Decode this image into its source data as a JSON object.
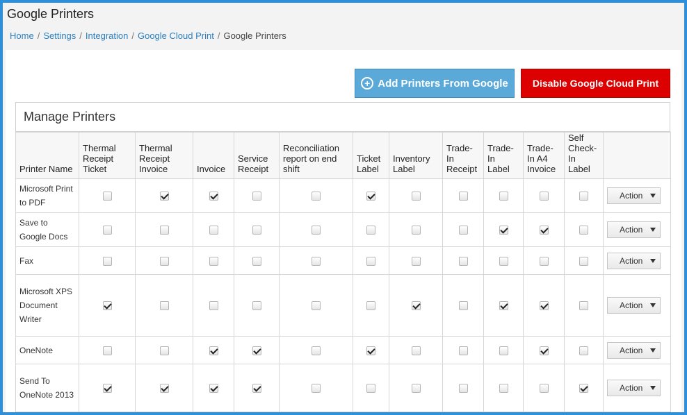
{
  "page": {
    "title": "Google Printers",
    "breadcrumb": [
      "Home",
      "Settings",
      "Integration",
      "Google Cloud Print"
    ],
    "breadcrumb_current": "Google Printers"
  },
  "toolbar": {
    "add_label": "Add Printers From Google",
    "disable_label": "Disable Google Cloud Print"
  },
  "panel": {
    "title": "Manage Printers"
  },
  "table": {
    "columns": [
      "Printer Name",
      "Thermal Receipt Ticket",
      "Thermal Receipt Invoice",
      "Invoice",
      "Service Receipt",
      "Reconciliation report on end shift",
      "Ticket Label",
      "Inventory Label",
      "Trade-In Receipt",
      "Trade-In Label",
      "Trade-In A4 Invoice",
      "Self Check-In Label",
      ""
    ],
    "action_label": "Action",
    "rows": [
      {
        "name": "Microsoft Print to PDF",
        "checks": [
          false,
          true,
          true,
          false,
          false,
          true,
          false,
          false,
          false,
          false,
          false
        ]
      },
      {
        "name": "Save to Google Docs",
        "checks": [
          false,
          false,
          false,
          false,
          false,
          false,
          false,
          false,
          true,
          true,
          false
        ]
      },
      {
        "name": "Fax",
        "checks": [
          false,
          false,
          false,
          false,
          false,
          false,
          false,
          false,
          false,
          false,
          false
        ]
      },
      {
        "name": "Microsoft XPS Document Writer",
        "checks": [
          true,
          false,
          false,
          false,
          false,
          false,
          true,
          false,
          true,
          true,
          false
        ]
      },
      {
        "name": "OneNote",
        "checks": [
          false,
          false,
          true,
          true,
          false,
          true,
          false,
          false,
          false,
          true,
          false
        ]
      },
      {
        "name": "Send To OneNote 2013",
        "checks": [
          true,
          true,
          true,
          true,
          false,
          false,
          false,
          false,
          false,
          false,
          true
        ]
      }
    ]
  },
  "colors": {
    "frame": "#2f8fd8",
    "add_button": "#5aa9d8",
    "disable_button": "#dd0000",
    "link": "#2a7fc0"
  }
}
